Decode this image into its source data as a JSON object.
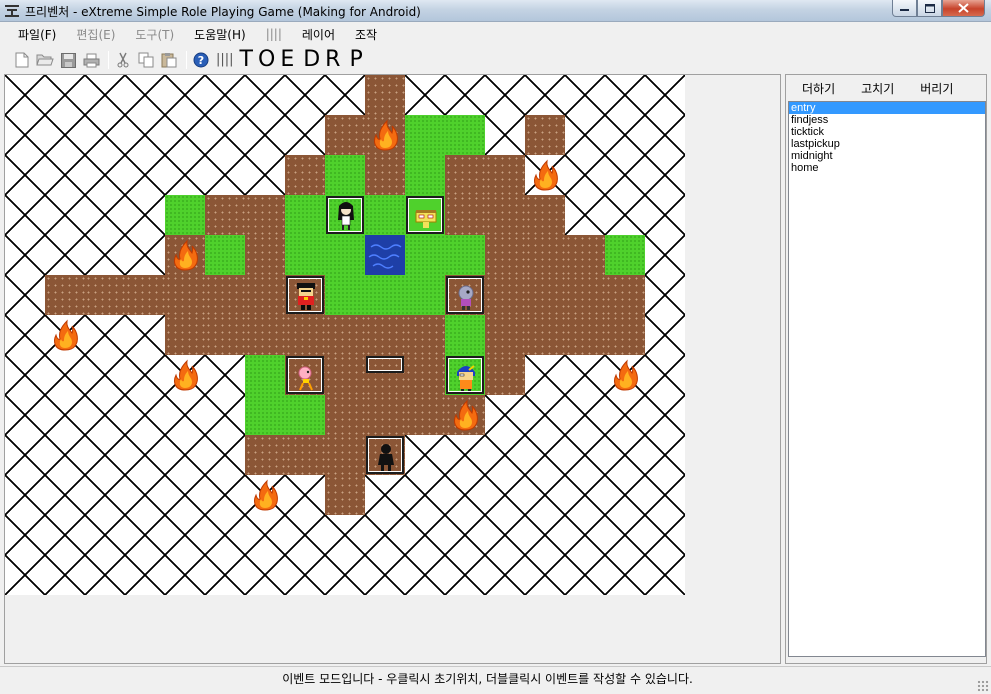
{
  "window": {
    "title": "프리벤처 - eXtreme Simple Role Playing Game (Making for Android)"
  },
  "menu": [
    {
      "label": "파일(F)",
      "disabled": false
    },
    {
      "label": "편집(E)",
      "disabled": true
    },
    {
      "label": "도구(T)",
      "disabled": true
    },
    {
      "label": "도움말(H)",
      "disabled": false
    },
    {
      "label": "||||",
      "disabled": true
    },
    {
      "label": "레이어",
      "disabled": false
    },
    {
      "label": "조작",
      "disabled": false
    }
  ],
  "toolbar": {
    "icons": [
      "new-file-icon",
      "open-folder-icon",
      "save-icon",
      "print-icon",
      "cut-icon",
      "copy-icon",
      "paste-icon",
      "help-icon"
    ],
    "divider": "||||",
    "modes": [
      "T",
      "O",
      "E",
      "D",
      "R",
      "P"
    ]
  },
  "side_panel": {
    "buttons": [
      "더하기",
      "고치기",
      "버리기"
    ],
    "events": [
      "entry",
      "findjess",
      "ticktick",
      "lastpickup",
      "midnight",
      "home"
    ],
    "selected_index": 0
  },
  "status": {
    "message": "이벤트 모드입니다 - 우클릭시 초기위치, 더블클릭시 이벤트를 작성할 수 있습니다."
  },
  "map": {
    "cols": 17,
    "rows": 13,
    "legend": {
      ".": "empty",
      "d": "dirt",
      "g": "grass",
      "w": "water"
    },
    "tiles": [
      ".........d.......",
      "........ddgg.d...",
      ".......dgdgdd....",
      "....gddggggddd...",
      "....dgdggwggdddg.",
      ".dddddddgggddddd.",
      "....dddddddgdddd.",
      "......gddddgd....",
      "......ggdddd.....",
      "......dddd.......",
      "........d........",
      "................."
    ],
    "objects": [
      {
        "type": "fire",
        "col": 9,
        "row": 1
      },
      {
        "type": "fire",
        "col": 13,
        "row": 2
      },
      {
        "type": "fire",
        "col": 4,
        "row": 4
      },
      {
        "type": "fire",
        "col": 1,
        "row": 6
      },
      {
        "type": "fire",
        "col": 4,
        "row": 7
      },
      {
        "type": "fire",
        "col": 15,
        "row": 7
      },
      {
        "type": "fire",
        "col": 11,
        "row": 8
      },
      {
        "type": "fire",
        "col": 6,
        "row": 10
      },
      {
        "type": "char-girl-black",
        "col": 8,
        "row": 3
      },
      {
        "type": "house",
        "col": 10,
        "row": 3
      },
      {
        "type": "char-boy-red",
        "col": 7,
        "row": 5
      },
      {
        "type": "char-grey",
        "col": 11,
        "row": 5
      },
      {
        "type": "char-pink",
        "col": 7,
        "row": 7
      },
      {
        "type": "signboard",
        "col": 9,
        "row": 7
      },
      {
        "type": "char-blue",
        "col": 11,
        "row": 7
      },
      {
        "type": "char-shadow",
        "col": 9,
        "row": 9
      }
    ]
  }
}
